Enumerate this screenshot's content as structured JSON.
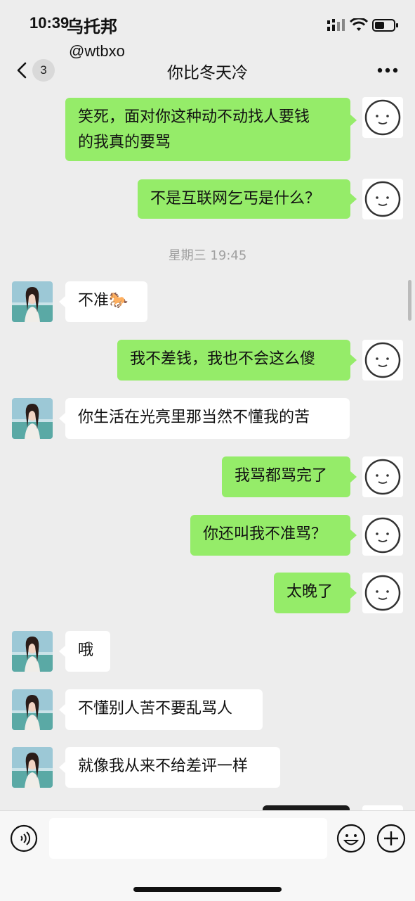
{
  "status_bar": {
    "time": "10:39"
  },
  "watermark": {
    "line1": "乌托邦",
    "line2": "@wtbxo"
  },
  "nav": {
    "back_label": "back",
    "unread_count": "3",
    "title": "你比冬天冷"
  },
  "messages": [
    {
      "side": "out",
      "text": "笑死，面对你这种动不动找人要钱\n的我真的要骂"
    },
    {
      "side": "out",
      "text": "不是互联网乞丐是什么？"
    },
    {
      "side": "in",
      "text": "不准🐎"
    },
    {
      "side": "out",
      "text": "我不差钱，我也不会这么傻"
    },
    {
      "side": "in",
      "text": "你生活在光亮里那当然不懂我的苦"
    },
    {
      "side": "out",
      "text": "我骂都骂完了"
    },
    {
      "side": "out",
      "text": "你还叫我不准骂？"
    },
    {
      "side": "out",
      "text": "太晚了"
    },
    {
      "side": "in",
      "text": "哦"
    },
    {
      "side": "in",
      "text": "不懂别人苦不要乱骂人"
    },
    {
      "side": "in",
      "text": "就像我从来不给差评一样"
    }
  ],
  "timestamp": "星期三 19:45",
  "colors": {
    "sent_bubble": "#95ec69",
    "received_bubble": "#ffffff",
    "background": "#ededed"
  },
  "icons": {
    "voice": "voice-icon",
    "emoji": "emoji-icon",
    "plus": "plus-icon",
    "more": "more-icon"
  }
}
